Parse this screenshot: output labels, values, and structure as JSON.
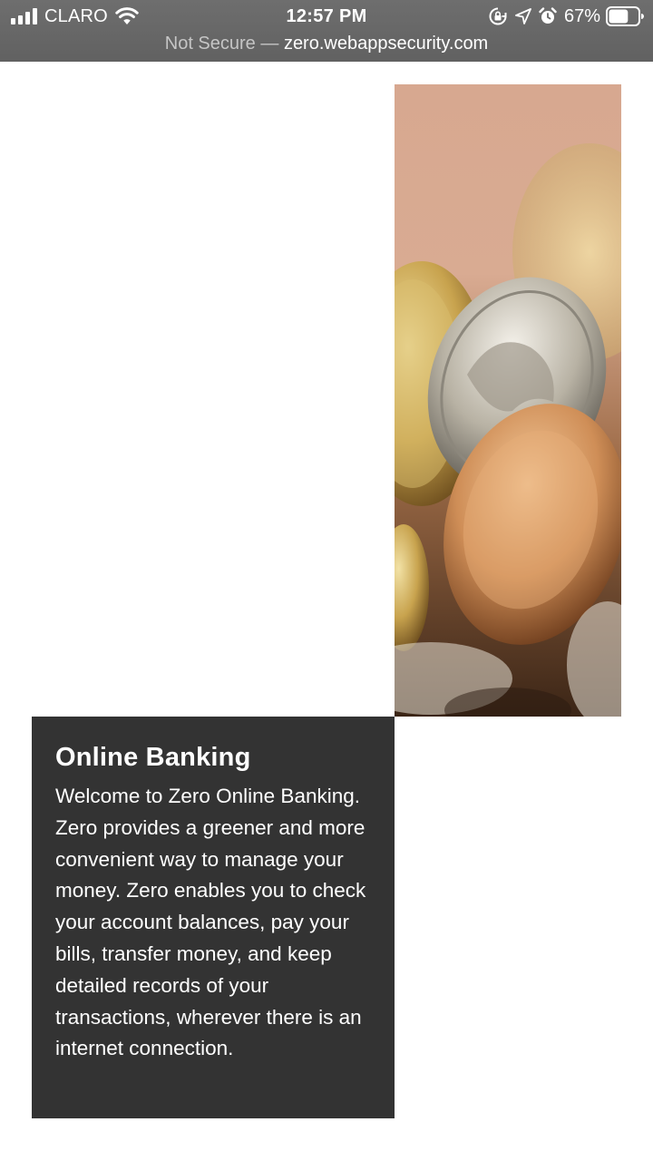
{
  "status_bar": {
    "carrier": "CLARO",
    "time": "12:57 PM",
    "battery_percent": "67%",
    "battery_level": 0.67,
    "icons": [
      "signal-icon",
      "wifi-icon",
      "orientation-lock-icon",
      "location-icon",
      "alarm-icon",
      "battery-icon"
    ]
  },
  "address_bar": {
    "security_label": "Not Secure",
    "separator": "—",
    "domain": "zero.webappsecurity.com"
  },
  "hero": {
    "image_subject": "coins-image"
  },
  "promo": {
    "title": "Online Banking",
    "body": "Welcome to Zero Online Banking. Zero provides a greener and more convenient way to manage your money. Zero enables you to check your account balances, pay your bills, transfer money, and keep detailed records of your transactions, wherever there is an internet connection."
  },
  "colors": {
    "topbar": "#656565",
    "panel": "#333333",
    "page_background": "#ffffff"
  }
}
